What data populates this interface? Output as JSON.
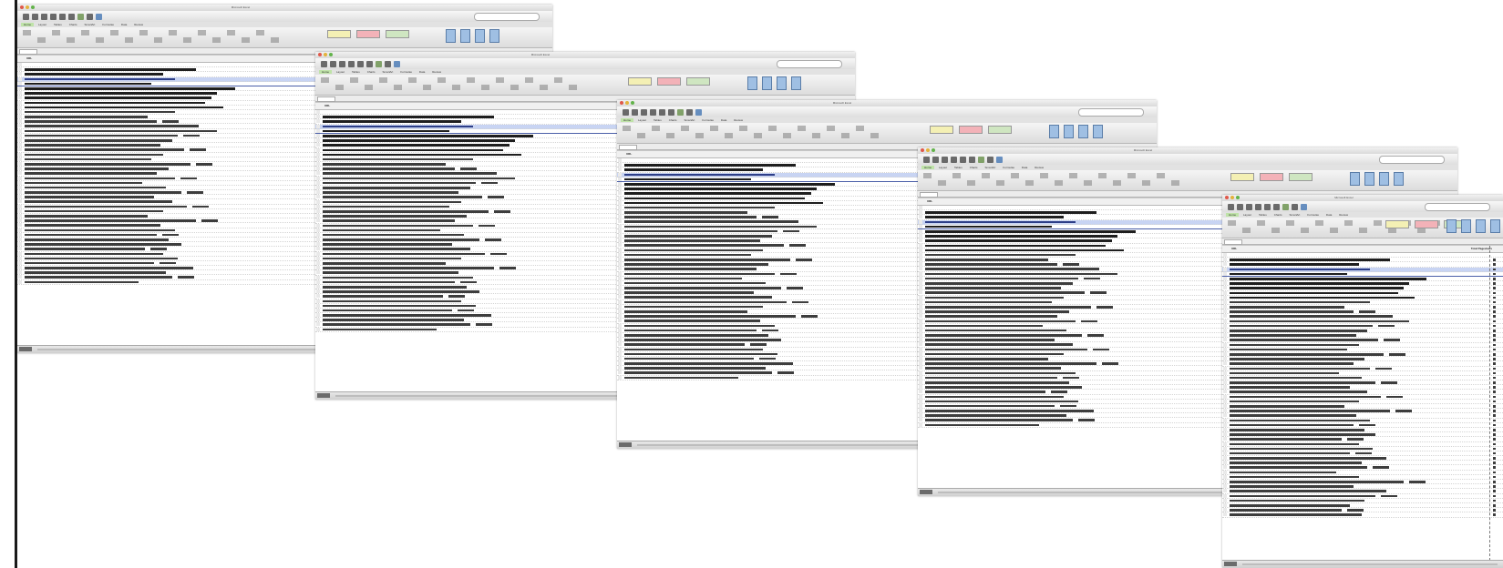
{
  "windows": [
    {
      "id": "w1",
      "title": "Microsoft Excel",
      "col_a_header": "URL",
      "col_b_header": "Total Pageviews",
      "search_placeholder": "Search in Sheet"
    },
    {
      "id": "w2",
      "title": "Microsoft Excel",
      "col_a_header": "URL",
      "col_b_header": "Total Pageviews",
      "search_placeholder": "Search in Sheet"
    },
    {
      "id": "w3",
      "title": "Microsoft Excel",
      "col_a_header": "URL",
      "col_b_header": "Total Pageviews",
      "search_placeholder": "Search in Sheet"
    },
    {
      "id": "w4",
      "title": "Microsoft Excel",
      "col_a_header": "URL",
      "col_b_header": "Total Pageviews",
      "search_placeholder": "Search in Sheet"
    },
    {
      "id": "w5",
      "title": "Microsoft Excel",
      "col_a_header": "URL",
      "col_b_header": "Total Pageviews",
      "search_placeholder": "Search in Sheet"
    }
  ],
  "ribbon_tabs": [
    "Home",
    "Layout",
    "Tables",
    "Charts",
    "SmartArt",
    "Formulas",
    "Data",
    "Review"
  ],
  "style_swatches": [
    "Neutral",
    "Bad",
    "Good"
  ],
  "colors": {
    "selection_row": "#c8d4f3",
    "selection_text": "#2d3e87",
    "ribbon_active_tab": "#bfe3a8",
    "style_neutral": "#f4f0b4",
    "style_bad": "#f3b2b8",
    "style_good": "#cfe6c1"
  },
  "icons": [
    "window-close-icon",
    "window-minimize-icon",
    "window-zoom-icon",
    "new-icon",
    "open-icon",
    "save-icon",
    "print-icon",
    "undo-icon",
    "redo-icon",
    "sum-icon",
    "sort-icon",
    "chart-icon",
    "sheet-tab-icon"
  ]
}
